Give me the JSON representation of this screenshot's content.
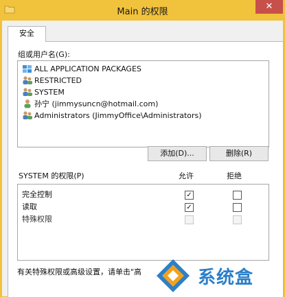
{
  "window": {
    "title": "Main 的权限",
    "close_glyph": "✕"
  },
  "tabs": [
    {
      "label": "安全"
    }
  ],
  "groups": {
    "label": "组或用户名(G):",
    "items": [
      {
        "label": "ALL APPLICATION PACKAGES",
        "icon": "package-group-icon"
      },
      {
        "label": "RESTRICTED",
        "icon": "users-group-icon"
      },
      {
        "label": "SYSTEM",
        "icon": "users-group-icon"
      },
      {
        "label": "孙宁 (jimmysuncn@hotmail.com)",
        "icon": "user-icon"
      },
      {
        "label": "Administrators (JimmyOffice\\Administrators)",
        "icon": "users-group-icon"
      }
    ]
  },
  "buttons": {
    "add": "添加(D)...",
    "remove": "删除(R)"
  },
  "permissions": {
    "label": "SYSTEM 的权限(P)",
    "allow_header": "允许",
    "deny_header": "拒绝",
    "rows": [
      {
        "name": "完全控制",
        "allow": true,
        "deny": false,
        "enabled": true
      },
      {
        "name": "读取",
        "allow": true,
        "deny": false,
        "enabled": true
      },
      {
        "name": "特殊权限",
        "allow": false,
        "deny": false,
        "enabled": false
      }
    ]
  },
  "footer": {
    "text": "有关特殊权限或高级设置，请单击\"高"
  },
  "watermark": {
    "text": "系统盒"
  },
  "colors": {
    "titlebar": "#f1c23b",
    "close": "#c7504a",
    "accent": "#2b7fc9"
  }
}
